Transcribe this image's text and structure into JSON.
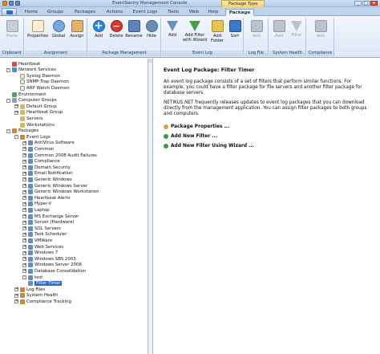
{
  "window": {
    "title": "EventSentry Management Console",
    "context_tab_group": "Package Type"
  },
  "menu_tabs": [
    "Home",
    "Groups",
    "Packages",
    "Actions",
    "Event Logs",
    "Tools",
    "Web",
    "Help",
    "Package"
  ],
  "active_tab": "Package",
  "ribbon": {
    "groups": [
      {
        "label": "Clipboard",
        "buttons": [
          {
            "label": "Paste",
            "icon": "paste-icon",
            "enabled": false
          }
        ]
      },
      {
        "label": "Assignment",
        "buttons": [
          {
            "label": "Properties",
            "icon": "properties-icon",
            "enabled": true
          },
          {
            "label": "Global",
            "icon": "global-icon",
            "enabled": true
          },
          {
            "label": "Assign",
            "icon": "assign-icon",
            "enabled": true
          }
        ]
      },
      {
        "label": "Package Management",
        "buttons": [
          {
            "label": "Add",
            "icon": "add-icon",
            "enabled": true
          },
          {
            "label": "Delete",
            "icon": "delete-icon",
            "enabled": true
          },
          {
            "label": "Rename",
            "icon": "rename-icon",
            "enabled": true
          },
          {
            "label": "Hide",
            "icon": "hide-icon",
            "enabled": true
          }
        ]
      },
      {
        "label": "Event Log",
        "buttons": [
          {
            "label": "Add",
            "icon": "funnel-icon",
            "enabled": true
          },
          {
            "label": "Add Filter with Wizard",
            "icon": "wizard-icon",
            "enabled": true
          },
          {
            "label": "Add Folder",
            "icon": "folder-icon",
            "enabled": true
          },
          {
            "label": "Sort",
            "icon": "sort-icon",
            "enabled": true
          }
        ]
      },
      {
        "label": "Log File",
        "buttons": [
          {
            "label": "Add",
            "icon": "log-file-icon",
            "enabled": false
          }
        ]
      },
      {
        "label": "System Health",
        "buttons": [
          {
            "label": "Add",
            "icon": "system-health-icon",
            "enabled": false
          },
          {
            "label": "Filter",
            "icon": "filter-icon",
            "enabled": false
          }
        ]
      },
      {
        "label": "Compliance",
        "buttons": [
          {
            "label": "Add",
            "icon": "compliance-icon",
            "enabled": false
          }
        ]
      }
    ]
  },
  "tree": {
    "items": [
      {
        "label": "Heartbeat",
        "depth": 1,
        "expander": "",
        "icon": "heartbeat-icon"
      },
      {
        "label": "Network Services",
        "depth": 1,
        "expander": "-",
        "icon": "network-icon"
      },
      {
        "label": "Syslog Daemon",
        "depth": 2,
        "expander": "",
        "icon": "doc-icon"
      },
      {
        "label": "SNMP Trap Daemon",
        "depth": 2,
        "expander": "",
        "icon": "doc-icon"
      },
      {
        "label": "ARP Watch Daemon",
        "depth": 2,
        "expander": "",
        "icon": "doc-icon"
      },
      {
        "label": "Environment",
        "depth": 1,
        "expander": "",
        "icon": "environment-icon"
      },
      {
        "label": "Computer Groups",
        "depth": 1,
        "expander": "-",
        "icon": "computer-icon"
      },
      {
        "label": "Default Group",
        "depth": 2,
        "expander": "+",
        "icon": "group-icon"
      },
      {
        "label": "Heartbeat Group",
        "depth": 2,
        "expander": "+",
        "icon": "group-icon"
      },
      {
        "label": "Servers",
        "depth": 2,
        "expander": "",
        "icon": "group-icon"
      },
      {
        "label": "Workstations",
        "depth": 2,
        "expander": "",
        "icon": "group-icon"
      },
      {
        "label": "Packages",
        "depth": 1,
        "expander": "-",
        "icon": "package-icon"
      },
      {
        "label": "Event Logs",
        "depth": 2,
        "expander": "-",
        "icon": "package-icon"
      },
      {
        "label": "AntiVirus Software",
        "depth": 3,
        "expander": "+",
        "icon": "filter-icon"
      },
      {
        "label": "Common",
        "depth": 3,
        "expander": "+",
        "icon": "filter-icon"
      },
      {
        "label": "Common 2008 Audit Failures",
        "depth": 3,
        "expander": "+",
        "icon": "filter-icon"
      },
      {
        "label": "Compliance",
        "depth": 3,
        "expander": "+",
        "icon": "filter-icon"
      },
      {
        "label": "Domain Security",
        "depth": 3,
        "expander": "+",
        "icon": "filter-icon"
      },
      {
        "label": "Email Notification",
        "depth": 3,
        "expander": "+",
        "icon": "filter-icon"
      },
      {
        "label": "Generic Windows",
        "depth": 3,
        "expander": "+",
        "icon": "filter-icon"
      },
      {
        "label": "Generic Windows Server",
        "depth": 3,
        "expander": "+",
        "icon": "filter-icon"
      },
      {
        "label": "Generic Windows Workstation",
        "depth": 3,
        "expander": "+",
        "icon": "filter-icon"
      },
      {
        "label": "Heartbeat Alerts",
        "depth": 3,
        "expander": "+",
        "icon": "filter-icon"
      },
      {
        "label": "Hyper-V",
        "depth": 3,
        "expander": "+",
        "icon": "filter-icon"
      },
      {
        "label": "Laptop",
        "depth": 3,
        "expander": "+",
        "icon": "filter-icon"
      },
      {
        "label": "MS Exchange Server",
        "depth": 3,
        "expander": "+",
        "icon": "filter-icon"
      },
      {
        "label": "Server (Hardware)",
        "depth": 3,
        "expander": "+",
        "icon": "filter-icon"
      },
      {
        "label": "SQL Servers",
        "depth": 3,
        "expander": "+",
        "icon": "filter-icon"
      },
      {
        "label": "Task Scheduler",
        "depth": 3,
        "expander": "+",
        "icon": "filter-icon"
      },
      {
        "label": "VMWare",
        "depth": 3,
        "expander": "+",
        "icon": "filter-icon"
      },
      {
        "label": "Web Services",
        "depth": 3,
        "expander": "+",
        "icon": "filter-icon"
      },
      {
        "label": "Windows 7",
        "depth": 3,
        "expander": "+",
        "icon": "filter-icon"
      },
      {
        "label": "Windows SBS 2003",
        "depth": 3,
        "expander": "+",
        "icon": "filter-icon"
      },
      {
        "label": "Windows Server 2008",
        "depth": 3,
        "expander": "+",
        "icon": "filter-icon"
      },
      {
        "label": "Database Consolidation",
        "depth": 3,
        "expander": "+",
        "icon": "filter-icon"
      },
      {
        "label": "test",
        "depth": 3,
        "expander": "-",
        "icon": "filter-icon"
      },
      {
        "label": "Filter Timer",
        "depth": 3,
        "expander": "",
        "icon": "filter-icon",
        "selected": true
      },
      {
        "label": "Log Files",
        "depth": 2,
        "expander": "+",
        "icon": "package-icon"
      },
      {
        "label": "System Health",
        "depth": 2,
        "expander": "+",
        "icon": "package-icon"
      },
      {
        "label": "Compliance Tracking",
        "depth": 2,
        "expander": "+",
        "icon": "package-icon"
      }
    ]
  },
  "detail": {
    "title": "Event Log Package: Filter Timer",
    "paragraph1": "An event log package consists of a set of filters that perform similar functions. For example, you could have a filter package for file servers and another filter package for database servers.",
    "paragraph2": "NETIKUS.NET frequently releases updates to event log packages that you can download directly from the management application. You can assign filter packages to both groups and computers.",
    "actions": [
      {
        "label": "Package Properties ...",
        "icon": "package-properties-icon"
      },
      {
        "label": "Add New Filter ...",
        "icon": "add-filter-icon"
      },
      {
        "label": "Add New Filter Using Wizard ...",
        "icon": "add-filter-wizard-icon"
      }
    ]
  },
  "colors": {
    "ribbon_bg": "#dde8f6",
    "selection": "#3169c6",
    "context_tab": "#eed27a"
  }
}
